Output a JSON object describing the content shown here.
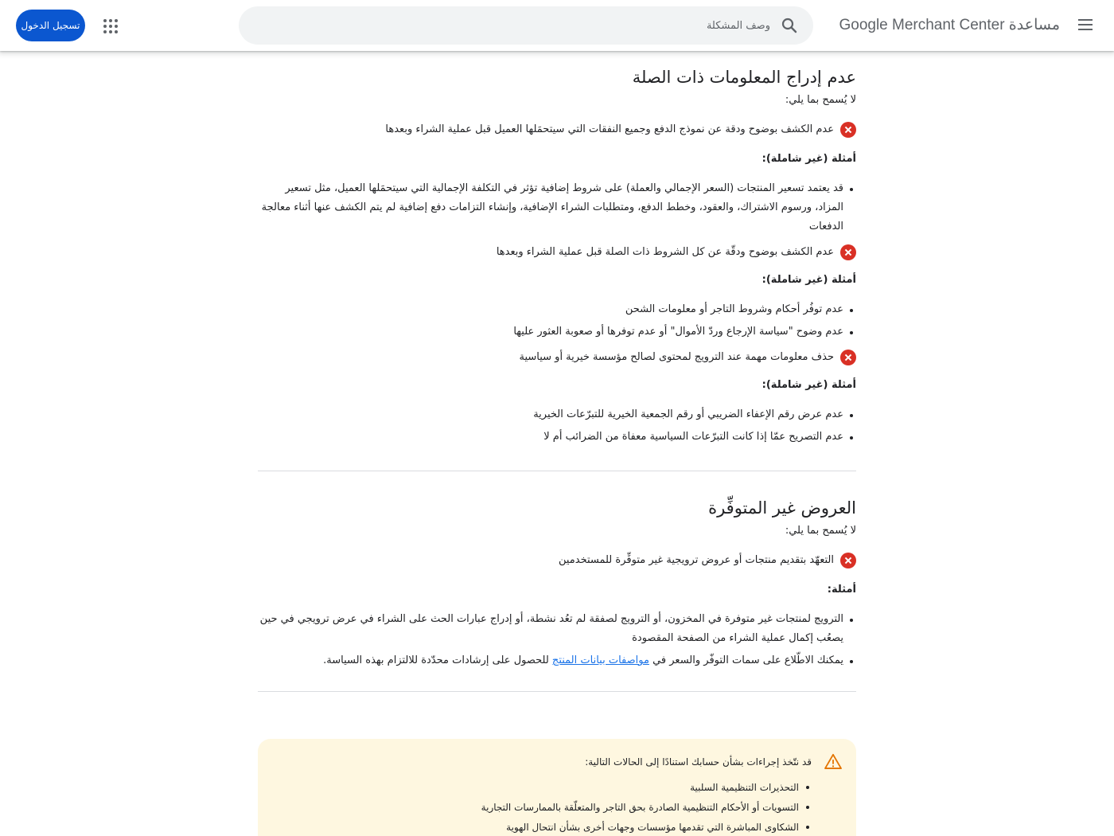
{
  "header": {
    "brand": "مساعدة Google Merchant Center",
    "search_placeholder": "وصف المشكلة",
    "signin_label": "تسجيل الدخول"
  },
  "section1": {
    "title": "عدم إدراج المعلومات ذات الصلة",
    "lead": "لا يُسمح بما يلي:",
    "rules": [
      {
        "text": "عدم الكشف بوضوح ودقة عن نموذج الدفع وجميع النفقات التي سيتحمَلها العميل قبل عملية الشراء وبعدها",
        "examples_label": "أمثلة (غير شاملة):",
        "examples": [
          "قد يعتمد تسعير المنتجات (السعر الإجمالي والعملة) على شروط إضافية تؤثر في التكلفة الإجمالية التي سيتحمَلها العميل، مثل تسعير المزاد، ورسوم الاشتراك، والعقود، وخطط الدفع، ومتطلبات الشراء الإضافية، وإنشاء التزامات دفع إضافية لم يتم الكشف عنها أثناء معالجة الدفعات"
        ]
      },
      {
        "text": "عدم الكشف بوضوح ودقّة عن كل الشروط ذات الصلة قبل عملية الشراء وبعدها",
        "examples_label": "أمثلة (غير شاملة):",
        "examples": [
          "عدم توفُر أحكام وشروط التاجر أو معلومات الشحن",
          "عدم وضوح \"سياسة الإرجاع وردّ الأموال\" أو عدم توفرها أو صعوبة العثور عليها"
        ]
      },
      {
        "text": "حذف معلومات مهمة عند الترويج لمحتوى لصالح مؤسسة خيرية أو سياسية",
        "examples_label": "أمثلة (غير شاملة):",
        "examples": [
          "عدم عرض رقم الإعفاء الضريبي أو رقم الجمعية الخيرية للتبرّعات الخيرية",
          "عدم التصريح عمّا إذا كانت التبرّعات السياسية معفاة من الضرائب أم لا"
        ]
      }
    ]
  },
  "section2": {
    "title": "العروض غير المتوفِّرة",
    "lead": "لا يُسمح بما يلي:",
    "rule": "التعهّد بتقديم منتجات أو عروض ترويجية غير متوفِّرة للمستخدمين",
    "examples_label": "أمثلة:",
    "example1": "الترويج لمنتجات غير متوفرة في المخزون، أو الترويج لصفقة لم تعُد نشطة، أو إدراج عبارات الحث على الشراء في عرض ترويجي في حين يصعُب إكمال عملية الشراء من الصفحة المقصودة",
    "example2_before": "يمكنك الاطّلاع على سمات التوفّر والسعر في ",
    "example2_link": "مواصفات بيانات المنتج",
    "example2_after": " للحصول على إرشادات محدّدة للالتزام بهذه السياسة."
  },
  "notice": {
    "lead": "قد نتّخذ إجراءات بشأن حسابك استنادًا إلى الحالات التالية:",
    "items": [
      "التحذيرات التنظيمية السلبية",
      "التسويات أو الأحكام التنظيمية الصادرة بحق التاجر والمتعلّقة بالممارسات التجارية",
      "الشكاوى المباشرة التي تقدمها مؤسسات وجهات أخرى بشأن انتحال الهوية"
    ]
  },
  "colors": {
    "accent": "#0b57d0",
    "error": "#d93025",
    "warning": "#e37400",
    "notice_bg": "#fef7e0",
    "link": "#1a73e8"
  }
}
